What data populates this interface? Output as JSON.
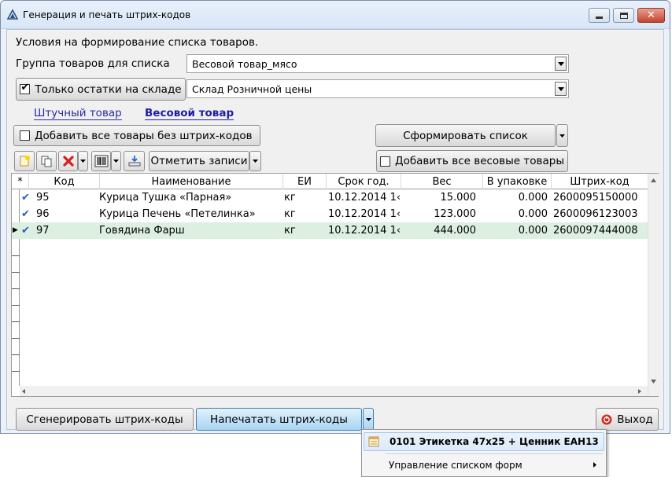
{
  "window": {
    "title": "Генерация и печать штрих-кодов"
  },
  "conditions": {
    "heading": "Условия на формирование списка товаров.",
    "group_label": "Группа товаров для списка",
    "group_value": "Весовой товар_мясо",
    "only_stock_label": "Только остатки на складе",
    "only_stock_checked": true,
    "warehouse_value": "Склад Розничной цены"
  },
  "tabs": [
    {
      "label": "Штучный товар",
      "active": false
    },
    {
      "label": "Весовой товар",
      "active": true
    }
  ],
  "actions": {
    "add_without_barcodes_label": "Добавить все товары без штрих-кодов",
    "form_list_label": "Сформировать список",
    "mark_records_label": "Отметить записи",
    "add_all_weight_label": "Добавить все весовые товары"
  },
  "toolbar_icons": [
    "new-record-icon",
    "copy-icon",
    "delete-icon",
    "barcode-icon",
    "import-icon"
  ],
  "table": {
    "columns": [
      "*",
      "Код",
      "Наименование",
      "ЕИ",
      "Срок год.",
      "Вес",
      "В упаковке",
      "Штрих-код"
    ],
    "rows": [
      {
        "checked": true,
        "code": "95",
        "name": "Курица Тушка  «Парная»",
        "unit": "кг",
        "expiry": "10.12.2014 1‹",
        "weight": "15.000",
        "pack": "0.000",
        "barcode": "2600095150000"
      },
      {
        "checked": true,
        "code": "96",
        "name": "Курица Печень  «Петелинка»",
        "unit": "кг",
        "expiry": "10.12.2014 1‹",
        "weight": "123.000",
        "pack": "0.000",
        "barcode": "2600096123003"
      },
      {
        "checked": true,
        "code": "97",
        "name": "Говядина Фарш",
        "unit": "кг",
        "expiry": "10.12.2014 1‹",
        "weight": "444.000",
        "pack": "0.000",
        "barcode": "2600097444008",
        "selected": true
      }
    ]
  },
  "footer": {
    "generate_label": "Сгенерировать штрих-коды",
    "print_label": "Напечатать штрих-коды",
    "exit_label": "Выход"
  },
  "print_menu": {
    "items": [
      {
        "label": "0101 Этикетка 47x25 + Ценник ЕАН13",
        "bold": true
      },
      {
        "label": "Управление списком форм",
        "has_submenu": true
      }
    ]
  },
  "colors": {
    "window_frame": "#eaf1fa",
    "selected_row": "#dcefe1",
    "check_mark": "#1f5fbf",
    "link": "#2a2aa8",
    "blue_button": "#c4e3f7"
  }
}
